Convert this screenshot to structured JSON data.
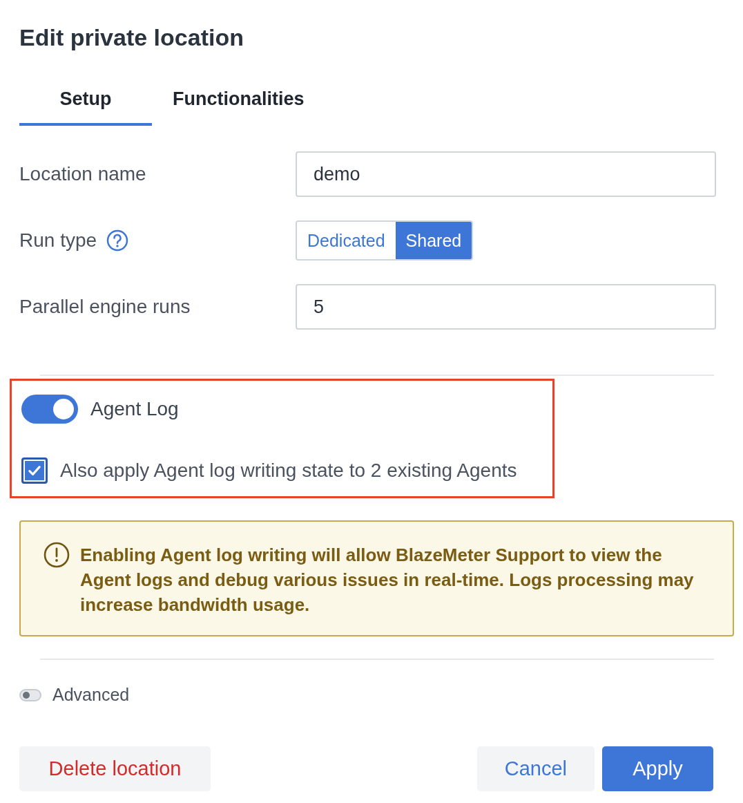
{
  "title": "Edit private location",
  "tabs": [
    {
      "label": "Setup",
      "selected": true
    },
    {
      "label": "Functionalities",
      "selected": false
    }
  ],
  "fields": [
    {
      "kind": "text",
      "label": "Location name",
      "value": "demo",
      "help_icon": false
    },
    {
      "kind": "segmented",
      "label": "Run type",
      "help_icon": true,
      "options": [
        {
          "label": "Dedicated",
          "selected": false
        },
        {
          "label": "Shared",
          "selected": true
        }
      ]
    },
    {
      "kind": "text",
      "label": "Parallel engine runs",
      "value": "5",
      "help_icon": false
    }
  ],
  "agent_log": {
    "label": "Agent Log",
    "on": true,
    "highlighted": true,
    "apply_existing": {
      "label": "Also apply Agent log writing state to 2 existing Agents",
      "checked": true
    }
  },
  "warning": {
    "text": "Enabling Agent log writing will allow BlazeMeter Support to view the Agent logs and debug various issues in real-time. Logs processing may increase bandwidth usage."
  },
  "advanced": {
    "label": "Advanced",
    "on": false
  },
  "buttons": [
    {
      "kind": "danger",
      "label": "Delete location"
    },
    {
      "kind": "secondary",
      "label": "Cancel"
    },
    {
      "kind": "primary",
      "label": "Apply"
    }
  ]
}
